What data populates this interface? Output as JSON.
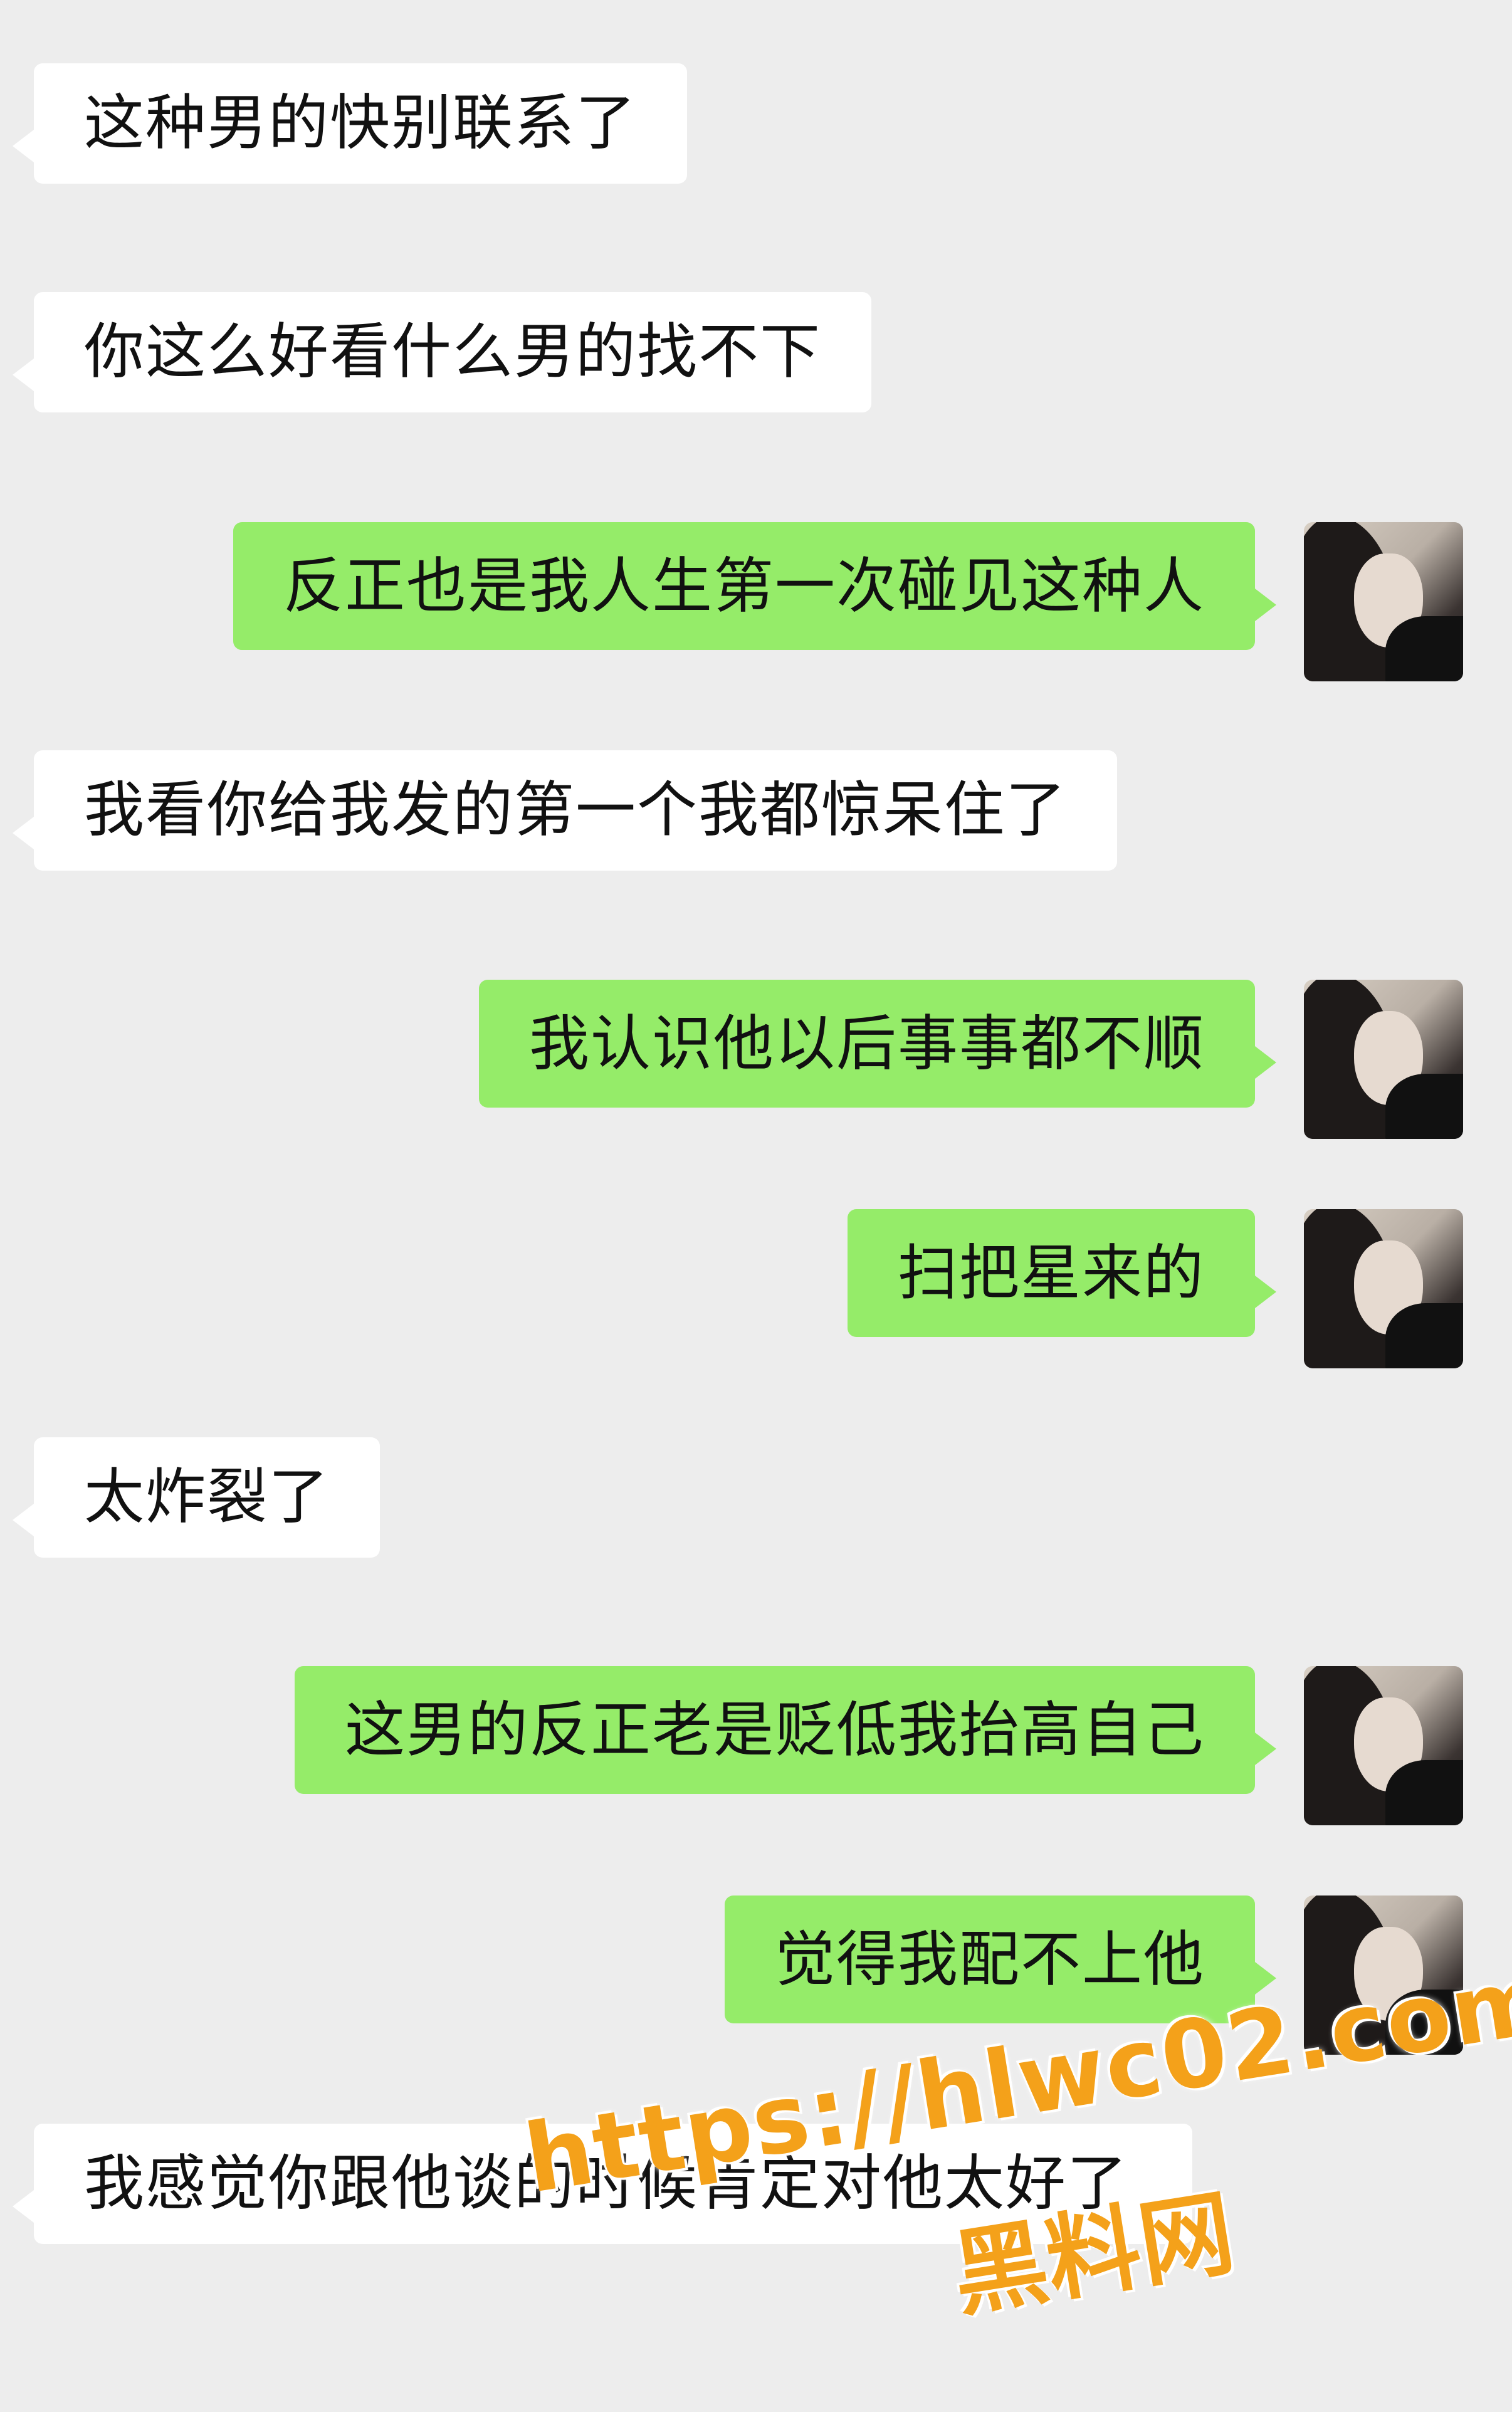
{
  "messages": [
    {
      "side": "left",
      "text": "这种男的快别联系了"
    },
    {
      "side": "left",
      "text": "你这么好看什么男的找不下"
    },
    {
      "side": "right",
      "text": "反正也是我人生第一次碰见这种人"
    },
    {
      "side": "left",
      "text": "我看你给我发的第一个我都惊呆住了"
    },
    {
      "side": "right",
      "text": "我认识他以后事事都不顺"
    },
    {
      "side": "right",
      "text": "扫把星来的"
    },
    {
      "side": "left",
      "text": "太炸裂了"
    },
    {
      "side": "right",
      "text": "这男的反正老是贬低我抬高自己"
    },
    {
      "side": "right",
      "text": "觉得我配不上他"
    },
    {
      "side": "left",
      "text": "我感觉你跟他谈的时候肯定对他太好了"
    }
  ],
  "watermark": {
    "url": "https://hlwc02.com",
    "name": "黑料网"
  },
  "colors": {
    "background": "#ededed",
    "incoming_bubble": "#ffffff",
    "outgoing_bubble": "#95ec69",
    "watermark": "#f4a11a"
  }
}
